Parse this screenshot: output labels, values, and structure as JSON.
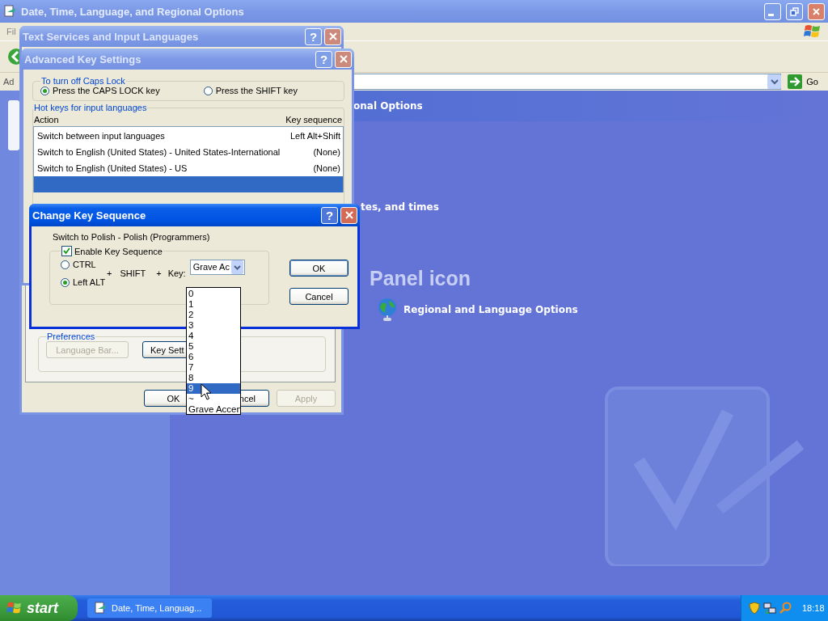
{
  "main_window": {
    "title": "Date, Time, Language, and Regional Options",
    "menu_bar": [
      "Fil"
    ],
    "address_bar": {
      "label": "Ad",
      "go_button": "Go"
    },
    "content": {
      "header": "onal Options",
      "task_fragment": "tes, and times",
      "section_title": "Panel icon",
      "links": [
        {
          "label": "Regional and Language Options"
        }
      ]
    }
  },
  "text_services_dialog": {
    "title": "Text Services and Input Languages",
    "help_button": "?",
    "preferences": {
      "legend": "Preferences",
      "buttons": [
        {
          "label": "Language Bar...",
          "disabled": true
        },
        {
          "label": "Key Sett",
          "disabled": false
        }
      ]
    },
    "buttons": [
      {
        "label": "OK",
        "disabled": false
      },
      {
        "label": "ncel",
        "disabled": false
      },
      {
        "label": "Apply",
        "disabled": true
      }
    ]
  },
  "advanced_key_settings": {
    "title": "Advanced Key Settings",
    "help_button": "?",
    "caps_lock": {
      "legend": "To turn off Caps Lock",
      "options": [
        {
          "label": "Press the CAPS LOCK key",
          "selected": true
        },
        {
          "label": "Press the SHIFT key",
          "selected": false
        }
      ]
    },
    "hot_keys": {
      "legend": "Hot keys for input languages",
      "columns": [
        "Action",
        "Key sequence"
      ],
      "rows": [
        {
          "action": "Switch between input languages",
          "key": "Left Alt+Shift",
          "selected": false
        },
        {
          "action": "Switch to English (United States) - United States-International",
          "key": "(None)",
          "selected": false
        },
        {
          "action": "Switch to English (United States) - US",
          "key": "(None)",
          "selected": false
        },
        {
          "selected": true
        }
      ]
    }
  },
  "change_key_sequence": {
    "title": "Change Key Sequence",
    "help_button": "?",
    "action": "Switch to Polish - Polish (Programmers)",
    "enable": {
      "label": "Enable Key Sequence",
      "checked": true
    },
    "modifiers": [
      {
        "label": "CTRL",
        "selected": false
      },
      {
        "label": "Left ALT",
        "selected": true
      }
    ],
    "plus_1": "+",
    "shift": "SHIFT",
    "plus_2": "+",
    "key_label": "Key:",
    "key_combo": {
      "value": "Grave Ac",
      "options": [
        {
          "label": "0",
          "selected": false
        },
        {
          "label": "1",
          "selected": false
        },
        {
          "label": "2",
          "selected": false
        },
        {
          "label": "3",
          "selected": false
        },
        {
          "label": "4",
          "selected": false
        },
        {
          "label": "5",
          "selected": false
        },
        {
          "label": "6",
          "selected": false
        },
        {
          "label": "7",
          "selected": false
        },
        {
          "label": "8",
          "selected": false
        },
        {
          "label": "9",
          "selected": true
        },
        {
          "label": "~",
          "selected": false
        },
        {
          "label": "Grave Accen",
          "selected": false
        }
      ]
    },
    "buttons": [
      "OK",
      "Cancel"
    ]
  },
  "taskbar": {
    "start": "start",
    "tasks": [
      {
        "label": "Date, Time, Languag...",
        "selected": false
      }
    ],
    "clock": "18:18"
  }
}
